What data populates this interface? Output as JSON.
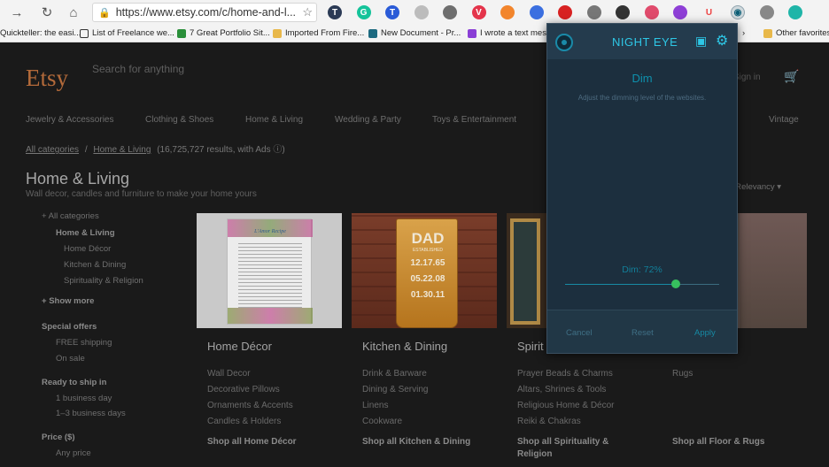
{
  "browser": {
    "url": "https://www.etsy.com/c/home-and-l...",
    "bookmarks": [
      "Quickteller: the easi...",
      "List of Freelance we...",
      "7 Great Portfolio Sit...",
      "Imported From Fire...",
      "New Document - Pr...",
      "I wrote a text mess...",
      "Other favorites"
    ],
    "extensions": [
      {
        "letter": "T",
        "color": "#2b3a55"
      },
      {
        "letter": "G",
        "color": "#15c39a"
      },
      {
        "letter": "T",
        "color": "#2a5bd7"
      },
      {
        "letter": "",
        "color": "#bcbcbc"
      },
      {
        "letter": "",
        "color": "#6e6e6e"
      },
      {
        "letter": "V",
        "color": "#e4344b"
      },
      {
        "letter": "",
        "color": "#f2852c"
      },
      {
        "letter": "",
        "color": "#3b6fe0"
      },
      {
        "letter": "",
        "color": "#d82222"
      },
      {
        "letter": "",
        "color": "#777"
      },
      {
        "letter": "",
        "color": "#333"
      },
      {
        "letter": "",
        "color": "#e04b6c"
      },
      {
        "letter": "",
        "color": "#8e3fd6"
      },
      {
        "letter": "U",
        "color": "#f3f3f3"
      },
      {
        "letter": "◉",
        "color": "#cfd8dc"
      },
      {
        "letter": "",
        "color": "#888"
      },
      {
        "letter": "",
        "color": "#1fb5a8"
      }
    ]
  },
  "etsy": {
    "logo": "Etsy",
    "search_placeholder": "Search for anything",
    "sign_in": "Sign in",
    "categories": [
      "Jewelry & Accessories",
      "Clothing & Shoes",
      "Home & Living",
      "Wedding & Party",
      "Toys & Entertainment",
      "Vintage"
    ],
    "breadcrumb": {
      "all": "All categories",
      "sep": "/",
      "current": "Home & Living",
      "results": "(16,725,727 results, with Ads ⓘ)"
    },
    "title": "Home & Living",
    "subtitle": "Wall decor, candles and furniture to make your home yours",
    "sort": "by: Relevancy ▾",
    "sidebar": [
      {
        "label": "All categories",
        "bold": false,
        "indent": 0
      },
      {
        "label": "Home & Living",
        "bold": true,
        "indent": 1
      },
      {
        "label": "Home Décor",
        "bold": false,
        "indent": 2
      },
      {
        "label": "Kitchen & Dining",
        "bold": false,
        "indent": 2
      },
      {
        "label": "Spirituality & Religion",
        "bold": false,
        "indent": 2
      },
      {
        "label": "Show more",
        "bold": true,
        "indent": 0
      },
      {
        "label": "Special offers",
        "bold": true,
        "indent": 0
      },
      {
        "label": "FREE shipping",
        "bold": false,
        "indent": 1
      },
      {
        "label": "On sale",
        "bold": false,
        "indent": 1
      },
      {
        "label": "Ready to ship in",
        "bold": true,
        "indent": 0
      },
      {
        "label": "1 business day",
        "bold": false,
        "indent": 1
      },
      {
        "label": "1–3 business days",
        "bold": false,
        "indent": 1
      },
      {
        "label": "Price ($)",
        "bold": true,
        "indent": 0
      },
      {
        "label": "Any price",
        "bold": false,
        "indent": 1
      }
    ],
    "cards": [
      {
        "title": "Home Décor",
        "links": [
          "Wall Decor",
          "Decorative Pillows",
          "Ornaments & Accents",
          "Candles & Holders"
        ],
        "shop": "Shop all Home Décor"
      },
      {
        "title": "Kitchen & Dining",
        "links": [
          "Drink & Barware",
          "Dining & Serving",
          "Linens",
          "Cookware"
        ],
        "shop": "Shop all Kitchen & Dining"
      },
      {
        "title": "Spirit",
        "links": [
          "Prayer Beads & Charms",
          "Altars, Shrines & Tools",
          "Religious Home & Décor",
          "Reiki & Chakras"
        ],
        "shop": "Shop all Spirituality & Religion"
      },
      {
        "title": "",
        "links": [
          "Rugs"
        ],
        "shop": "Shop all Floor & Rugs"
      }
    ],
    "poster_title": "L'Amor Recipe",
    "dad_glass": {
      "top": "DAD",
      "sub": "ESTABLISHED",
      "dates": [
        "12.17.65",
        "05.22.08",
        "01.30.11"
      ]
    }
  },
  "night_eye": {
    "title": "NIGHT EYE",
    "mode": "Dim",
    "description": "Adjust the dimming level of the websites.",
    "value_label": "Dim: 72%",
    "dim_fraction": 0.72,
    "buttons": {
      "cancel": "Cancel",
      "reset": "Reset",
      "apply": "Apply"
    }
  },
  "colors": {
    "accent": "#2ec7e6",
    "slider_knob": "#37c05e",
    "etsy_orange": "#b36a3a"
  }
}
